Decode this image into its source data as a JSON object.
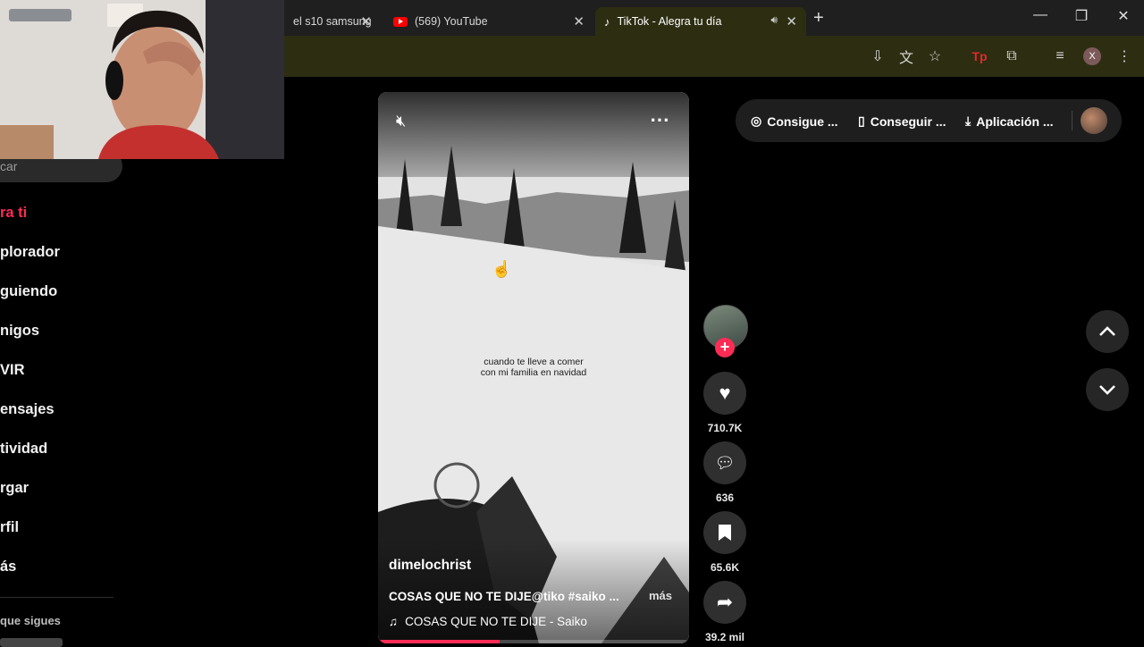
{
  "browser": {
    "tabs": [
      {
        "title": "el s10 samsung",
        "active": false
      },
      {
        "title": "(569) YouTube",
        "active": false
      },
      {
        "title": "TikTok - Alegra tu día",
        "active": true
      }
    ],
    "new_tab": "+",
    "window_controls": {
      "minimize": "—",
      "maximize": "❐",
      "close": "✕"
    },
    "profile_letter": "X"
  },
  "sidebar": {
    "search_fragment": "car",
    "items": [
      {
        "label": "ra ti",
        "active": true
      },
      {
        "label": "plorador"
      },
      {
        "label": "guiendo"
      },
      {
        "label": "nigos"
      },
      {
        "label": "VIR"
      },
      {
        "label": "ensajes"
      },
      {
        "label": "tividad"
      },
      {
        "label": "rgar"
      },
      {
        "label": "rfil"
      },
      {
        "label": "ás"
      }
    ],
    "following_heading": "que sigues"
  },
  "video": {
    "caption_line1": "cuando te lleve a comer",
    "caption_line2": "con mi familia en navidad",
    "username": "dimelochrist",
    "description": "COSAS QUE NO TE DIJE@tiko #saiko ...",
    "more_label": "más",
    "music": "COSAS QUE NO TE DIJE - Saiko",
    "progress": 0.39
  },
  "actions": {
    "likes": "710.7K",
    "comments": "636",
    "saves": "65.6K",
    "shares": "39.2 mil"
  },
  "topbar": {
    "coins": "Consigue ...",
    "get_app": "Conseguir ...",
    "app": "Aplicación ..."
  },
  "colors": {
    "accent": "#fe2c55",
    "toolbar": "#2d2d12"
  }
}
